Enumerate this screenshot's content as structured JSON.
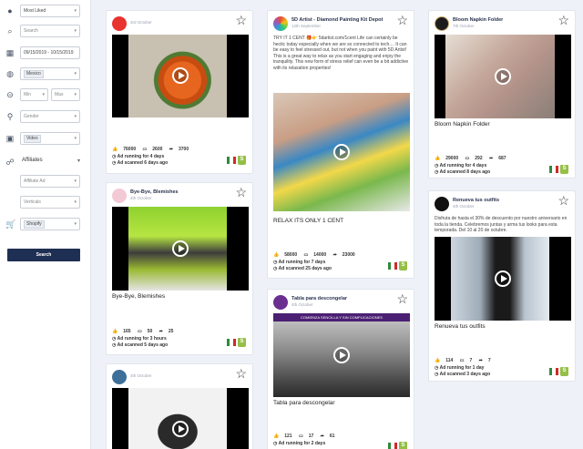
{
  "sidebar": {
    "sort": "Most Liked",
    "search_placeholder": "Search",
    "date_range": "09/15/2019 - 10/15/2019",
    "country_chip": "Mexico",
    "min_placeholder": "Min",
    "max_placeholder": "Max",
    "gender_placeholder": "Gender",
    "media_chip": "Video",
    "affiliates_label": "Affiliates",
    "affiliate_ad": "Affiliate Ad",
    "verticals": "Verticals",
    "platform_chip": "Shopify",
    "search_button": "Search"
  },
  "cards": [
    {
      "name": "",
      "date": "3rd October",
      "title": "",
      "likes": "76000",
      "comments": "2600",
      "shares": "3700",
      "running": "Ad running for 4 days",
      "scanned": "Ad scanned 6 days ago"
    },
    {
      "name": "Bye-Bye, Blemishes",
      "date": "4th October",
      "title": "Bye-Bye, Blemishes",
      "likes": "165",
      "comments": "50",
      "shares": "25",
      "running": "Ad running for 3 hours",
      "scanned": "Ad scanned 5 days ago"
    },
    {
      "name": "",
      "date": "4th October",
      "title": ""
    },
    {
      "name": "5D Artist - Diamond Painting Kit Depot",
      "date": "12th September",
      "desc": "TRY IT 1 CENT 🎁👉 5dartist.com/1cent Life can certainly be hectic today especially when we are so connected to tech.... It can be easy to feel stressed out, but not when you paint with 5D Artist! This is a great way to relax as you start engaging and enjoy the tranquility. This new form of stress relief can even be a bit addictive with its relaxation properties!",
      "title": "RELAX ITS ONLY 1 CENT",
      "likes": "58000",
      "comments": "14000",
      "shares": "23000",
      "running": "Ad running for 7 days",
      "scanned": "Ad scanned 25 days ago"
    },
    {
      "name": "Tabla para descongelar",
      "date": "4th October",
      "banner": "COMIENZA SENCILLA Y SIN COMPLICACIONES",
      "title": "Tabla para descongelar",
      "likes": "121",
      "comments": "17",
      "shares": "61",
      "running": "Ad running for 2 days"
    },
    {
      "name": "Bloom Napkin Folder",
      "date": "7th October",
      "title": "Bloom Napkin Folder",
      "likes": "29000",
      "comments": "292",
      "shares": "687",
      "running": "Ad running for 4 days",
      "scanned": "Ad scanned 8 days ago"
    },
    {
      "name": "Renueva tus outfits",
      "date": "4th October",
      "desc": "Disfruta de hasta el 30% de descuento por nuestro aniversario en toda la tienda. Celebremos juntas y arma tus looks para esta temporada. Del 10 al 20 de octubre.",
      "title": "Renueva tus outfits",
      "likes": "114",
      "comments": "7",
      "shares": "7",
      "running": "Ad running for 1 day",
      "scanned": "Ad scanned 3 days ago"
    }
  ],
  "colors": {
    "accent": "#1f2f53",
    "shopify": "#95bf47",
    "mexico_green": "#2e8b3a",
    "mexico_red": "#cf2a2a"
  },
  "icons": [
    "trophy-icon",
    "search-icon",
    "calendar-icon",
    "globe-icon",
    "hash-icon",
    "gender-icon",
    "image-icon",
    "users-icon",
    "cart-icon",
    "star-icon",
    "play-icon",
    "like-icon",
    "comment-icon",
    "share-icon",
    "clock-icon",
    "scan-icon",
    "mexico-flag-icon",
    "shopify-icon"
  ]
}
